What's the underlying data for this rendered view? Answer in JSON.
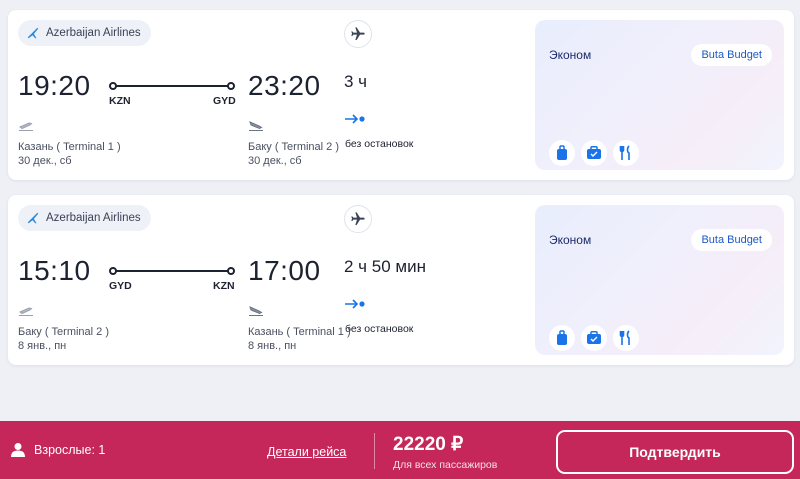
{
  "flights": [
    {
      "airline": "Azerbaijan Airlines",
      "dep_time": "19:20",
      "arr_time": "23:20",
      "dep_code": "KZN",
      "arr_code": "GYD",
      "duration": "3 ч",
      "stops": "без остановок",
      "dep_airport": "Казань ( Terminal 1 )",
      "dep_date": "30 дек., сб",
      "arr_airport": "Баку ( Terminal 2 )",
      "arr_date": "30 дек., сб",
      "fare_class": "Эконом",
      "fare_name": "Buta Budget"
    },
    {
      "airline": "Azerbaijan Airlines",
      "dep_time": "15:10",
      "arr_time": "17:00",
      "dep_code": "GYD",
      "arr_code": "KZN",
      "duration": "2 ч 50 мин",
      "stops": "без остановок",
      "dep_airport": "Баку ( Terminal 2 )",
      "dep_date": "8 янв., пн",
      "arr_airport": "Казань ( Terminal 1 )",
      "arr_date": "8 янв., пн",
      "fare_class": "Эконом",
      "fare_name": "Buta Budget"
    }
  ],
  "fare_icons": [
    "baggage-icon",
    "hand-luggage-icon",
    "meal-icon"
  ],
  "bottom_bar": {
    "passengers": "Взрослые: 1",
    "details_link": "Детали рейса",
    "price": "22220 ₽",
    "price_note": "Для всех пассажиров",
    "confirm_label": "Подтвердить"
  },
  "colors": {
    "accent": "#c5275a",
    "fare_badge_text": "#1b58c7",
    "icon_blue": "#1a73e8",
    "background": "#eef0f6"
  }
}
